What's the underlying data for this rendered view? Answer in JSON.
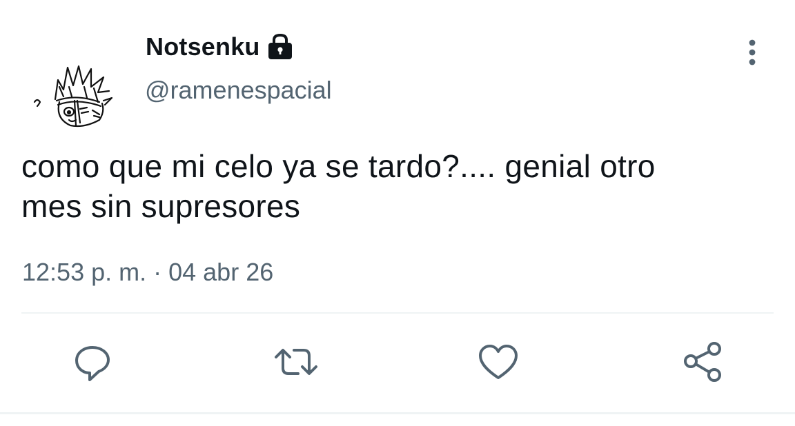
{
  "tweet": {
    "author": {
      "display_name": "Notsenku",
      "handle": "@ramenespacial",
      "avatar_icon": "avatar-manga-character",
      "protected_icon": "lock-icon"
    },
    "text_line_1": "como que mi celo ya se tardo?.... genial otro",
    "text_line_2": "mes sin supresores",
    "time": "12:53 p. m.",
    "separator": "·",
    "date": "04 abr 26",
    "more_icon": "more-vertical-icon"
  },
  "actions": {
    "reply_icon": "reply-icon",
    "retweet_icon": "retweet-icon",
    "like_icon": "heart-icon",
    "share_icon": "share-icon"
  },
  "colors": {
    "text_primary": "#0f1419",
    "text_secondary": "#536471",
    "icon": "#536471",
    "divider": "#eff3f4"
  }
}
